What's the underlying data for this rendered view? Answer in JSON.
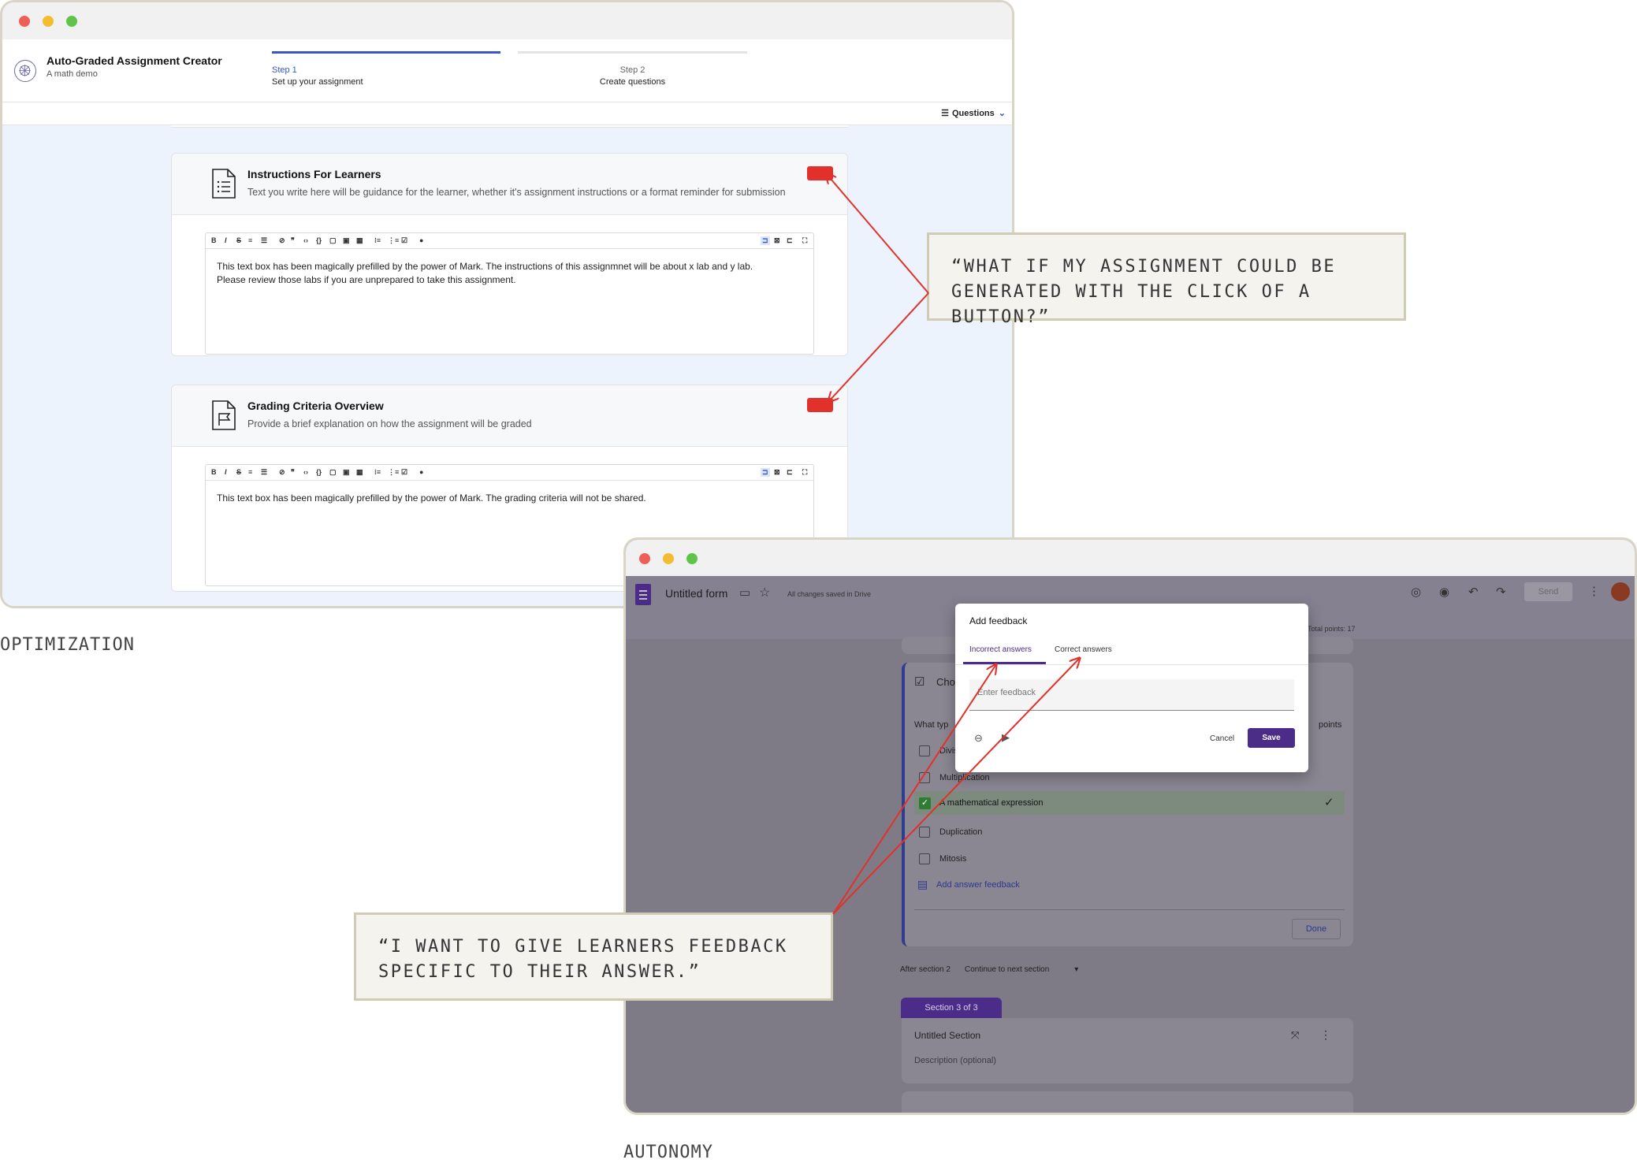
{
  "optimization_window": {
    "app_title": "Auto-Graded Assignment Creator",
    "app_subtitle": "A math demo",
    "steps": [
      {
        "label": "Step 1",
        "description": "Set up your assignment",
        "active": true
      },
      {
        "label": "Step 2",
        "description": "Create questions",
        "active": false
      }
    ],
    "questions_dropdown": "Questions",
    "cards": [
      {
        "title": "Instructions For Learners",
        "subtitle": "Text you write here will be guidance for the learner, whether it's assignment instructions or a format reminder for submission",
        "icon": "document-list-icon",
        "editor_text_line1": "This text box has been magically prefilled by the power of Mark. The instructions of this assignmnet will be about x lab and y lab.",
        "editor_text_line2": "Please review those labs if you are unprepared to take this assignment."
      },
      {
        "title": "Grading Criteria Overview",
        "subtitle": "Provide a brief explanation on how the assignment will be graded",
        "icon": "document-flag-icon",
        "editor_text_line1": "This text box has been magically prefilled by the power of Mark. The grading criteria will not be shared.",
        "editor_text_line2": ""
      }
    ]
  },
  "autonomy_window": {
    "form_title": "Untitled form",
    "save_status": "All changes saved in Drive",
    "send_label": "Send",
    "total_points": "Total points: 17",
    "question_partial_title": "Cho",
    "question_partial_prompt": "What typ",
    "points_label": "points",
    "options": [
      {
        "label": "Divis",
        "checked": false
      },
      {
        "label": "Multiplication",
        "checked": false
      },
      {
        "label": "A mathematical expression",
        "checked": true
      },
      {
        "label": "Duplication",
        "checked": false
      },
      {
        "label": "Mitosis",
        "checked": false
      }
    ],
    "add_feedback_link": "Add answer feedback",
    "done_label": "Done",
    "after_section_label": "After section 2",
    "after_section_value": "Continue to next section",
    "section_badge": "Section 3 of 3",
    "section_title": "Untitled Section",
    "section_description": "Description (optional)",
    "dialog": {
      "title": "Add feedback",
      "tab_incorrect": "Incorrect answers",
      "tab_correct": "Correct answers",
      "placeholder": "Enter feedback",
      "cancel_label": "Cancel",
      "save_label": "Save"
    }
  },
  "annotations": {
    "callout_top": "“WHAT IF MY ASSIGNMENT COULD BE GENERATED WITH THE CLICK OF A BUTTON?”",
    "callout_bottom": "“I WANT TO GIVE LEARNERS FEEDBACK SPECIFIC TO THEIR ANSWER.”",
    "caption_left": "OPTIMIZATION",
    "caption_right": "AUTONOMY"
  },
  "colors": {
    "accent_blue": "#3857c4",
    "annotation_red": "#e2312b",
    "forms_purple": "#4b2c89",
    "callout_bg": "#f4f3ee"
  }
}
